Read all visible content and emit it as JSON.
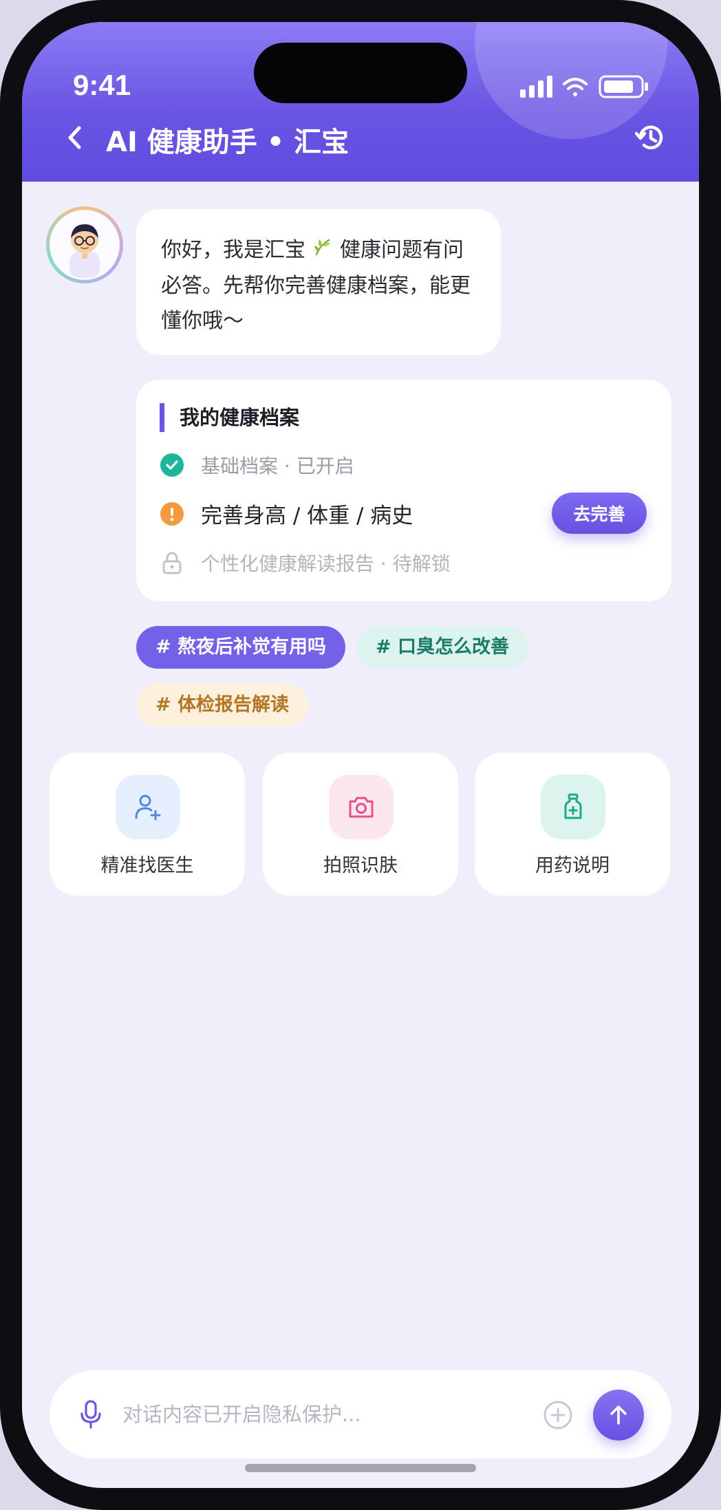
{
  "status_bar": {
    "time": "9:41"
  },
  "header": {
    "title": "AI 健康助手 • 汇宝"
  },
  "chat": {
    "greeting_part1": "你好，我是汇宝",
    "greeting_part2": "健康问题有问必答。先帮你完善健康档案，能更懂你哦～"
  },
  "profile_card": {
    "title": "我的健康档案",
    "items": [
      {
        "text": "基础档案 · 已开启",
        "status": "done"
      },
      {
        "text": "完善身高 / 体重 / 病史",
        "status": "pending"
      },
      {
        "text": "个性化健康解读报告 · 待解锁",
        "status": "locked"
      }
    ],
    "action_label": "去完善"
  },
  "topics": [
    "# 熬夜后补觉有用吗",
    "# 口臭怎么改善",
    "# 体检报告解读"
  ],
  "quick_actions": [
    {
      "label": "精准找医生",
      "icon": "user-plus-icon"
    },
    {
      "label": "拍照识肤",
      "icon": "camera-icon"
    },
    {
      "label": "用药说明",
      "icon": "medicine-bottle-icon"
    }
  ],
  "input": {
    "placeholder": "对话内容已开启隐私保护..."
  },
  "colors": {
    "primary": "#6a56e4",
    "success": "#1fb59a",
    "warning": "#f59a3c",
    "background": "#f1eefb"
  }
}
